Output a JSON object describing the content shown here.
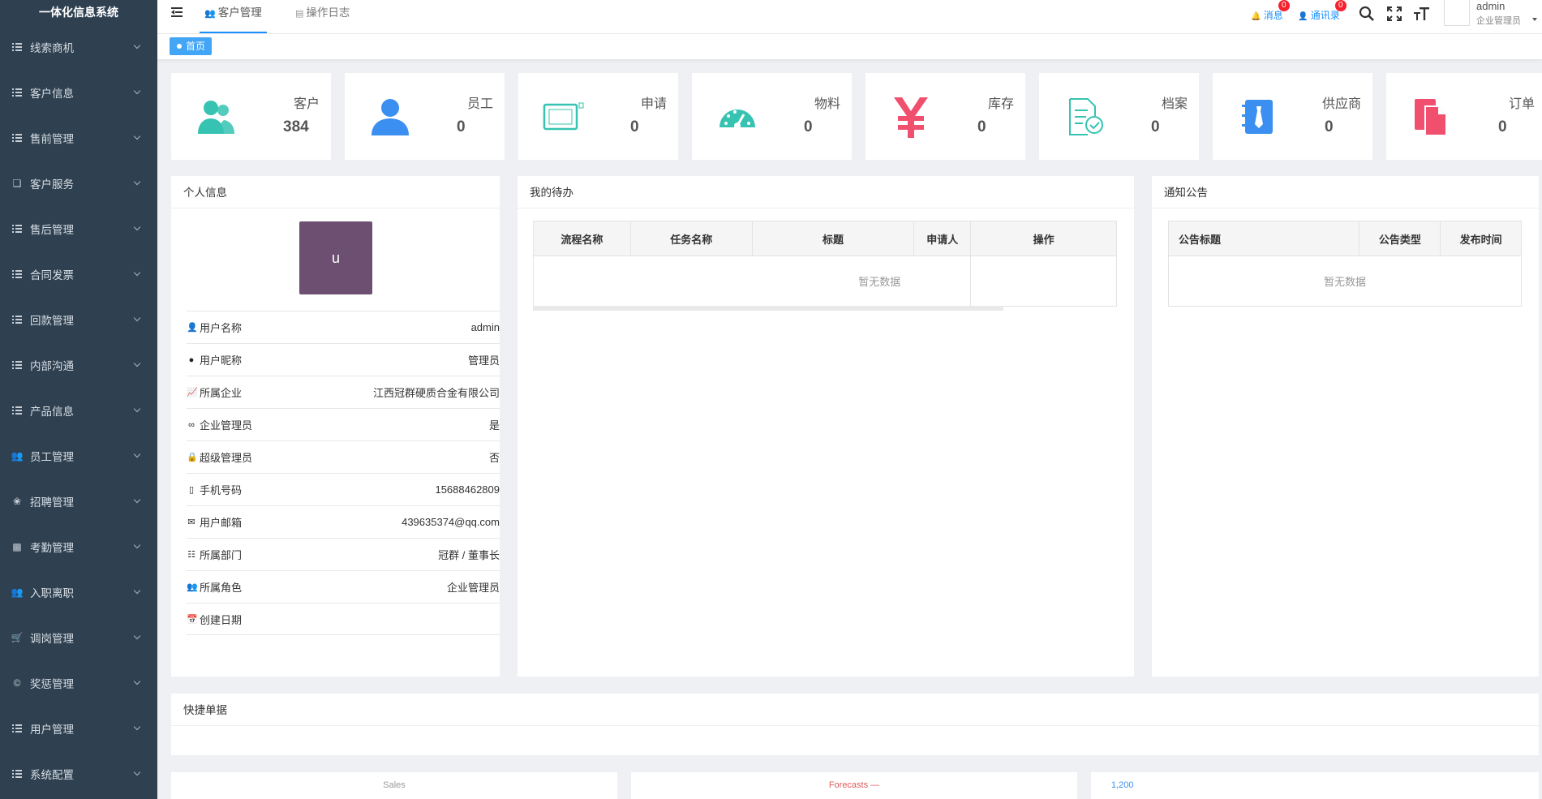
{
  "brand": "一体化信息系统",
  "sidebar": {
    "items": [
      {
        "label": "线索商机",
        "icon": "list-icon"
      },
      {
        "label": "客户信息",
        "icon": "list-icon"
      },
      {
        "label": "售前管理",
        "icon": "list-icon"
      },
      {
        "label": "客户服务",
        "icon": "copy-icon"
      },
      {
        "label": "售后管理",
        "icon": "list-icon"
      },
      {
        "label": "合同发票",
        "icon": "list-icon"
      },
      {
        "label": "回款管理",
        "icon": "list-icon"
      },
      {
        "label": "内部沟通",
        "icon": "list-icon"
      },
      {
        "label": "产品信息",
        "icon": "list-icon"
      },
      {
        "label": "员工管理",
        "icon": "users-icon"
      },
      {
        "label": "招聘管理",
        "icon": "bug-icon"
      },
      {
        "label": "考勤管理",
        "icon": "calendar-icon"
      },
      {
        "label": "入职离职",
        "icon": "users-icon"
      },
      {
        "label": "调岗管理",
        "icon": "cart-icon"
      },
      {
        "label": "奖惩管理",
        "icon": "copyright-icon"
      },
      {
        "label": "用户管理",
        "icon": "list-icon"
      },
      {
        "label": "系统配置",
        "icon": "list-icon"
      }
    ]
  },
  "topbar": {
    "tabs": [
      {
        "label": "客户管理",
        "icon": "users-icon",
        "active": true
      },
      {
        "label": "操作日志",
        "icon": "table-icon",
        "active": false
      }
    ],
    "message": {
      "label": "消息",
      "badge": "0"
    },
    "contacts": {
      "label": "通讯录",
      "badge": "0"
    },
    "user": {
      "name": "admin",
      "role": "企业管理员"
    }
  },
  "breadcrumb": {
    "home": "首页"
  },
  "stats": [
    {
      "label": "客户",
      "value": "384",
      "icon": "users-icon",
      "color": "#36c3b1"
    },
    {
      "label": "员工",
      "value": "0",
      "icon": "user-icon",
      "color": "#3b8ff1"
    },
    {
      "label": "申请",
      "value": "0",
      "icon": "tablet-icon",
      "color": "#36c3b1"
    },
    {
      "label": "物料",
      "value": "0",
      "icon": "dashboard-icon",
      "color": "#36c3b1"
    },
    {
      "label": "库存",
      "value": "0",
      "icon": "yen-icon",
      "color": "#f0506e"
    },
    {
      "label": "档案",
      "value": "0",
      "icon": "document-check-icon",
      "color": "#36c3b1"
    },
    {
      "label": "供应商",
      "value": "0",
      "icon": "notebook-icon",
      "color": "#3b8ff1"
    },
    {
      "label": "订单",
      "value": "0",
      "icon": "files-icon",
      "color": "#f0506e"
    }
  ],
  "profile": {
    "title": "个人信息",
    "avatar_letter": "u",
    "rows": [
      {
        "key": "用户名称",
        "value": "admin",
        "icon": "user-icon"
      },
      {
        "key": "用户昵称",
        "value": "管理员",
        "icon": "qq-icon"
      },
      {
        "key": "所属企业",
        "value": "江西冠群硬质合金有限公司",
        "icon": "chart-icon"
      },
      {
        "key": "企业管理员",
        "value": "是",
        "icon": "link-icon"
      },
      {
        "key": "超级管理员",
        "value": "否",
        "icon": "lock-icon"
      },
      {
        "key": "手机号码",
        "value": "15688462809",
        "icon": "phone-icon"
      },
      {
        "key": "用户邮箱",
        "value": "439635374@qq.com",
        "icon": "mail-icon"
      },
      {
        "key": "所属部门",
        "value": "冠群 / 董事长",
        "icon": "sitemap-icon"
      },
      {
        "key": "所属角色",
        "value": "企业管理员",
        "icon": "users-icon"
      },
      {
        "key": "创建日期",
        "value": "",
        "icon": "calendar-icon"
      }
    ]
  },
  "todo": {
    "title": "我的待办",
    "columns": [
      "流程名称",
      "任务名称",
      "标题",
      "申请人",
      "操作"
    ],
    "empty": "暂无数据"
  },
  "notice": {
    "title": "通知公告",
    "columns": [
      "公告标题",
      "公告类型",
      "发布时间"
    ],
    "empty": "暂无数据"
  },
  "quick": {
    "title": "快捷单据"
  },
  "charts": [
    {
      "title": "Sales",
      "color": "#999999"
    },
    {
      "title": "Forecasts",
      "color": "#e15b5b"
    },
    {
      "title": "1,200",
      "color": "#3b8ff1"
    }
  ]
}
